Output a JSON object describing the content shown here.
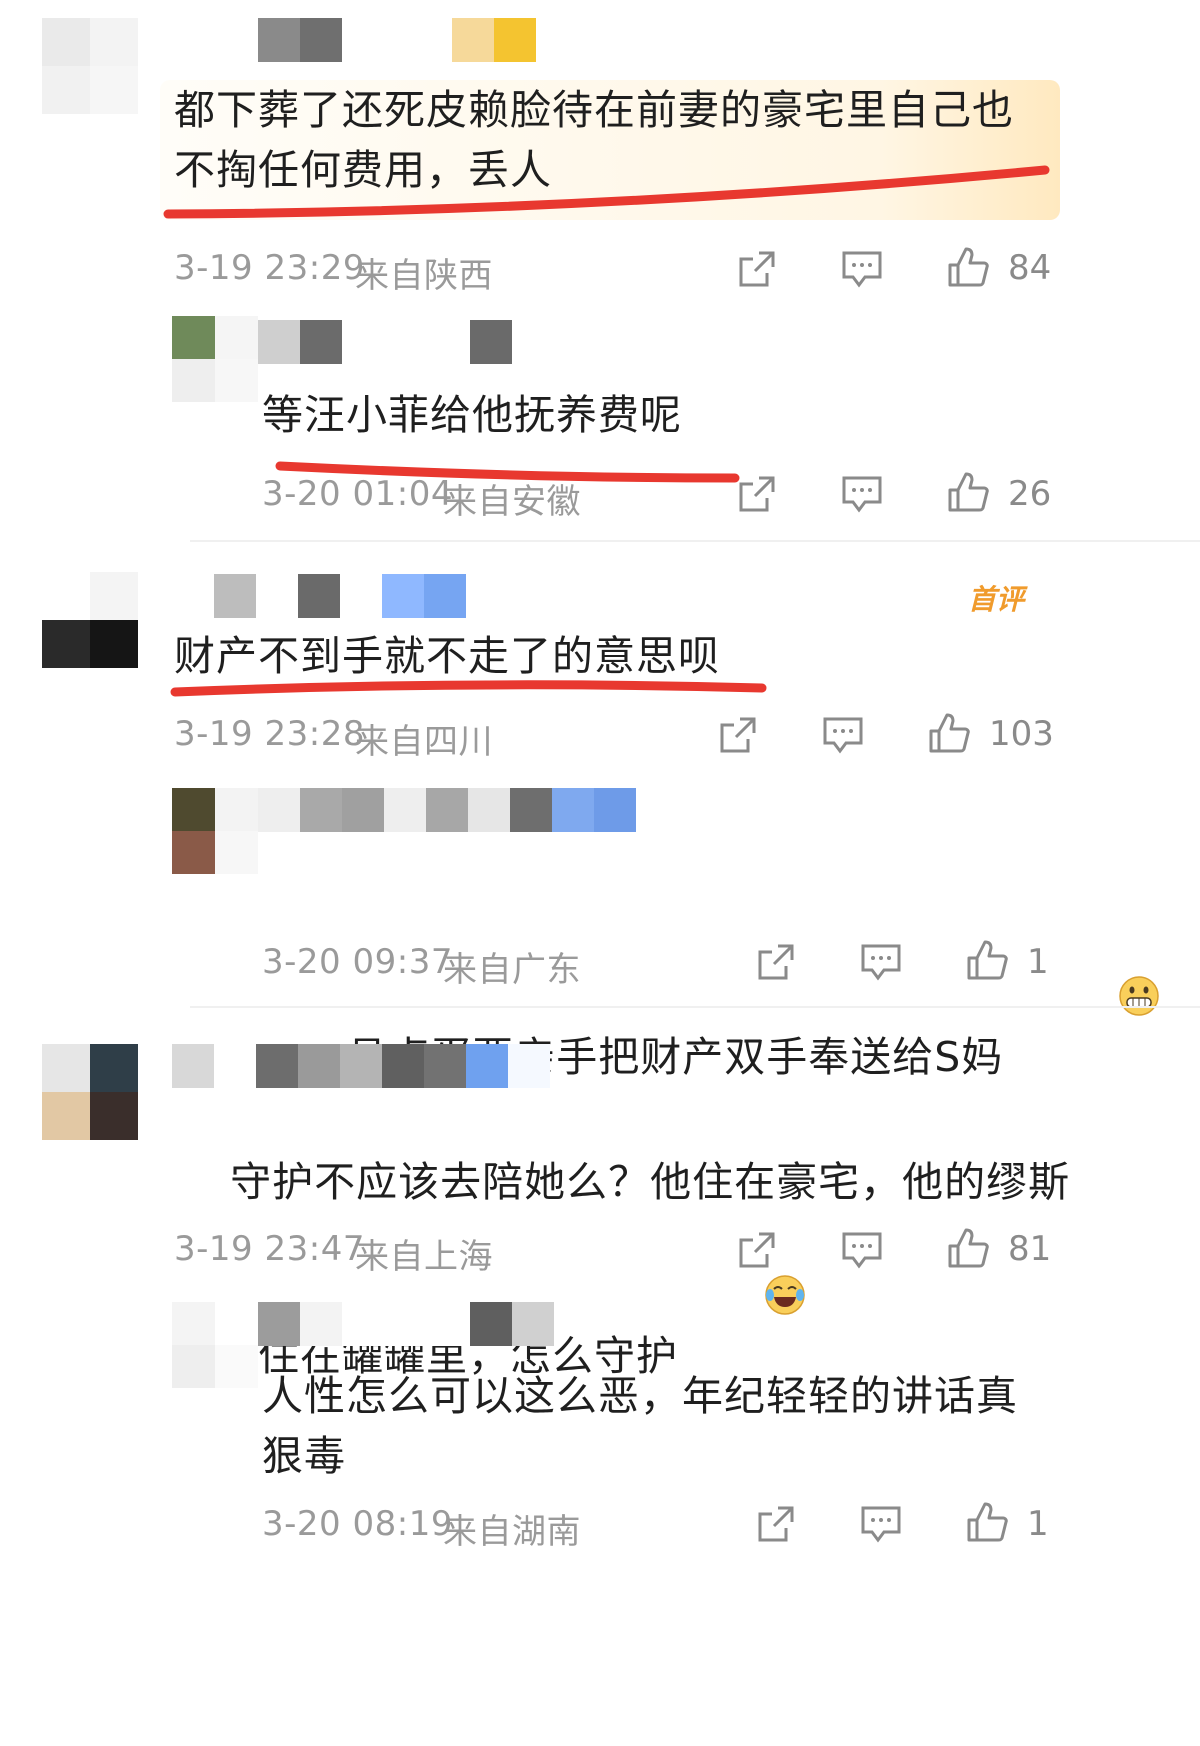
{
  "comments": [
    {
      "text": "都下葬了还死皮赖脸待在前妻的豪宅里自己也\n不掏任何费用，丢人",
      "time": "3-19 23:29",
      "location": "来自陕西",
      "likes": "84",
      "replies": [
        {
          "text": "等汪小菲给他抚养费呢",
          "time": "3-20 01:04",
          "location": "来自安徽",
          "likes": "26"
        }
      ]
    },
    {
      "badge": "首评",
      "text": "财产不到手就不走了的意思呗",
      "time": "3-19 23:28",
      "location": "来自四川",
      "likes": "103",
      "replies": [
        {
          "text": "具卤蛋要亲手把财产双手奉送给S妈",
          "emoji": "grinning-emoji",
          "time": "3-20 09:37",
          "location": "来自广东",
          "likes": "1"
        }
      ]
    },
    {
      "text": "守护不应该去陪她么？他住在豪宅，他的缪斯\n女神住在罐罐里，怎么守护",
      "emoji": "laughing-tears-emoji",
      "time": "3-19 23:47",
      "location": "来自上海",
      "likes": "81",
      "replies": [
        {
          "text": "人性怎么可以这么恶，年纪轻轻的讲话真\n狠毒",
          "time": "3-20 08:19",
          "location": "来自湖南",
          "likes": "1"
        }
      ]
    }
  ],
  "icons": {
    "share": "share-icon",
    "reply": "comment-icon",
    "like": "thumbs-up-icon"
  },
  "colors": {
    "annotation_red": "#e8382f",
    "meta_gray": "#9a9a9a",
    "badge_orange": "#f09b2c"
  }
}
